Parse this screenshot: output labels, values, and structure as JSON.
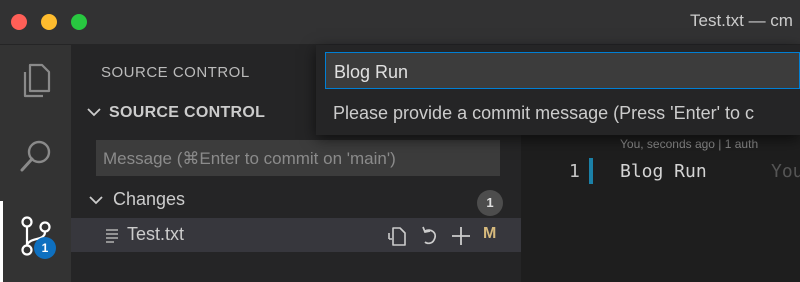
{
  "window": {
    "title": "Test.txt — cm"
  },
  "activity_bar": {
    "items": [
      {
        "icon": "files-icon",
        "label": "Explorer"
      },
      {
        "icon": "search-icon",
        "label": "Search"
      },
      {
        "icon": "source-control-icon",
        "label": "Source Control",
        "badge": "1"
      }
    ]
  },
  "sidebar": {
    "title": "SOURCE CONTROL",
    "section_title": "SOURCE CONTROL",
    "message_placeholder": "Message (⌘Enter to commit on 'main')",
    "changes": {
      "label": "Changes",
      "count": "1",
      "files": [
        {
          "name": "Test.txt",
          "status": "M"
        }
      ]
    }
  },
  "editor": {
    "blame_hint": "You, seconds ago | 1 auth",
    "lines": [
      {
        "number": "1",
        "text": "Blog Run",
        "inline_blame": "You"
      }
    ]
  },
  "quick_input": {
    "value": "Blog Run",
    "hint": "Please provide a commit message (Press 'Enter' to c"
  },
  "colors": {
    "accent": "#007fd4",
    "badge": "#0e70c0",
    "modified": "#d7ba7d"
  }
}
